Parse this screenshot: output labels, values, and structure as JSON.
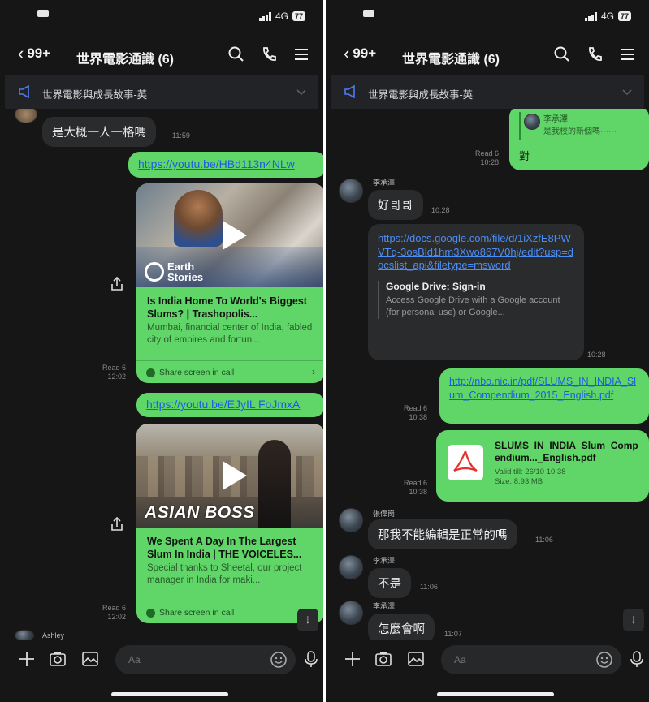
{
  "status": {
    "left_time": "",
    "network": "4G",
    "battery": "77"
  },
  "header": {
    "back_count": "99+",
    "title": "世界電影通識 (6)"
  },
  "announcement": "世界電影與成長故事-英",
  "left": {
    "msg_top": {
      "text": "是大概一人一格嗎",
      "time": "11:59"
    },
    "link1": "https://youtu.be/HBd113n4NLw",
    "card1": {
      "title": "Is India Home To World's Biggest Slums? | Trashopolis...",
      "desc": "Mumbai, financial center of India, fabled city of empires and fortun...",
      "share": "Share screen in call",
      "brand_top": "Earth",
      "brand_bottom": "Stories",
      "read": "Read 6",
      "time": "12:02"
    },
    "link2": "https://youtu.be/EJyIL FoJmxA",
    "card2": {
      "title": "We Spent A Day In The Largest Slum In India | THE VOICELES...",
      "desc": "Special thanks to Sheetal, our project manager in India for maki...",
      "share": "Share screen in call",
      "brand": "ASIAN BOSS",
      "read": "Read 6",
      "time": "12:02"
    },
    "bottom_name": "Ashley"
  },
  "right": {
    "quote": {
      "name": "李承澤",
      "text": "是我校的新個嗎⋯⋯",
      "reply": "對",
      "read": "Read 6",
      "time": "10:28"
    },
    "msg1": {
      "name": "李承澤",
      "text": "好哥哥",
      "time": "10:28"
    },
    "gdoc": {
      "url": "https://docs.google.com/file/d/1iXzfE8PWVTq-3osBld1hm3Xwo867V0hj/edit?usp=docslist_api&filetype=msword",
      "title": "Google Drive: Sign-in",
      "desc": "Access Google Drive with a Google account (for personal use) or Google...",
      "time": "10:28"
    },
    "link": {
      "url": "http://nbo.nic.in/pdf/SLUMS_IN_INDIA_Slum_Compendium_2015_English.pdf",
      "read": "Read 6",
      "time": "10:38"
    },
    "file": {
      "name": "SLUMS_IN_INDIA_Slum_Compendium..._English.pdf",
      "valid": "Valid till: 26/10 10:38",
      "size": "Size: 8.93 MB",
      "read": "Read 6",
      "time": "10:38"
    },
    "msg2": {
      "name": "張偉崗",
      "text": "那我不能編輯是正常的嗎",
      "time": "11:06"
    },
    "msg3": {
      "name": "李承澤",
      "text": "不是",
      "time": "11:06"
    },
    "msg4": {
      "name": "李承澤",
      "text": "怎麼會啊",
      "time": "11:07"
    }
  },
  "input": {
    "placeholder": "Aa"
  },
  "colors": {
    "bubble_green": "#5fd667",
    "link_blue": "#1f5be6",
    "bg": "#161616"
  },
  "icons": [
    "search-icon",
    "phone-icon",
    "menu-icon",
    "megaphone-icon",
    "chevron-down-icon",
    "plus-icon",
    "camera-icon",
    "image-icon",
    "emoji-icon",
    "mic-icon",
    "share-icon",
    "scroll-down-icon",
    "pdf-icon"
  ]
}
